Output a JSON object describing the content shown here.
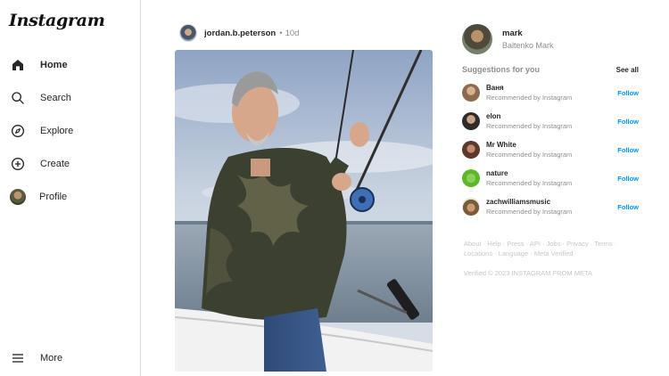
{
  "app": {
    "logo": "Instagram"
  },
  "sidebar": {
    "items": [
      {
        "label": "Home",
        "icon": "home-icon"
      },
      {
        "label": "Search",
        "icon": "search-icon"
      },
      {
        "label": "Explore",
        "icon": "compass-icon"
      },
      {
        "label": "Create",
        "icon": "plus-square-icon"
      },
      {
        "label": "Profile",
        "icon": "avatar"
      }
    ],
    "more": {
      "label": "More",
      "icon": "menu-icon"
    }
  },
  "post": {
    "username": "jordan.b.peterson",
    "separator": "•",
    "time": "10d"
  },
  "me": {
    "username": "mark",
    "name": "Baltenko Mark"
  },
  "suggestions": {
    "title": "Suggestions for you",
    "see_all": "See all",
    "items": [
      {
        "name": "Ваня",
        "sub": "Recommended by Instagram",
        "action": "Follow",
        "color": "#8a6a52"
      },
      {
        "name": "elon",
        "sub": "Recommended by Instagram",
        "action": "Follow",
        "color": "#2c2c2c"
      },
      {
        "name": "Mr White",
        "sub": "Recommended by Instagram",
        "action": "Follow",
        "color": "#5a3a2a"
      },
      {
        "name": "nature",
        "sub": "Recommended by Instagram",
        "action": "Follow",
        "color": "#5cb82a"
      },
      {
        "name": "zachwilliamsmusic",
        "sub": "Recommended by Instagram",
        "action": "Follow",
        "color": "#7a5a3a"
      }
    ]
  },
  "footer": {
    "links": [
      "About",
      "Help",
      "Press",
      "API",
      "Jobs",
      "Privacy",
      "Terms",
      "Locations",
      "Language",
      "Meta Verified"
    ],
    "separator": " · ",
    "copyright": "Verified © 2023 INSTAGRAM FROM META"
  },
  "colors": {
    "accent": "#0095f6",
    "text": "#262626",
    "muted": "#8e8e8e",
    "border": "#dbdbdb"
  }
}
